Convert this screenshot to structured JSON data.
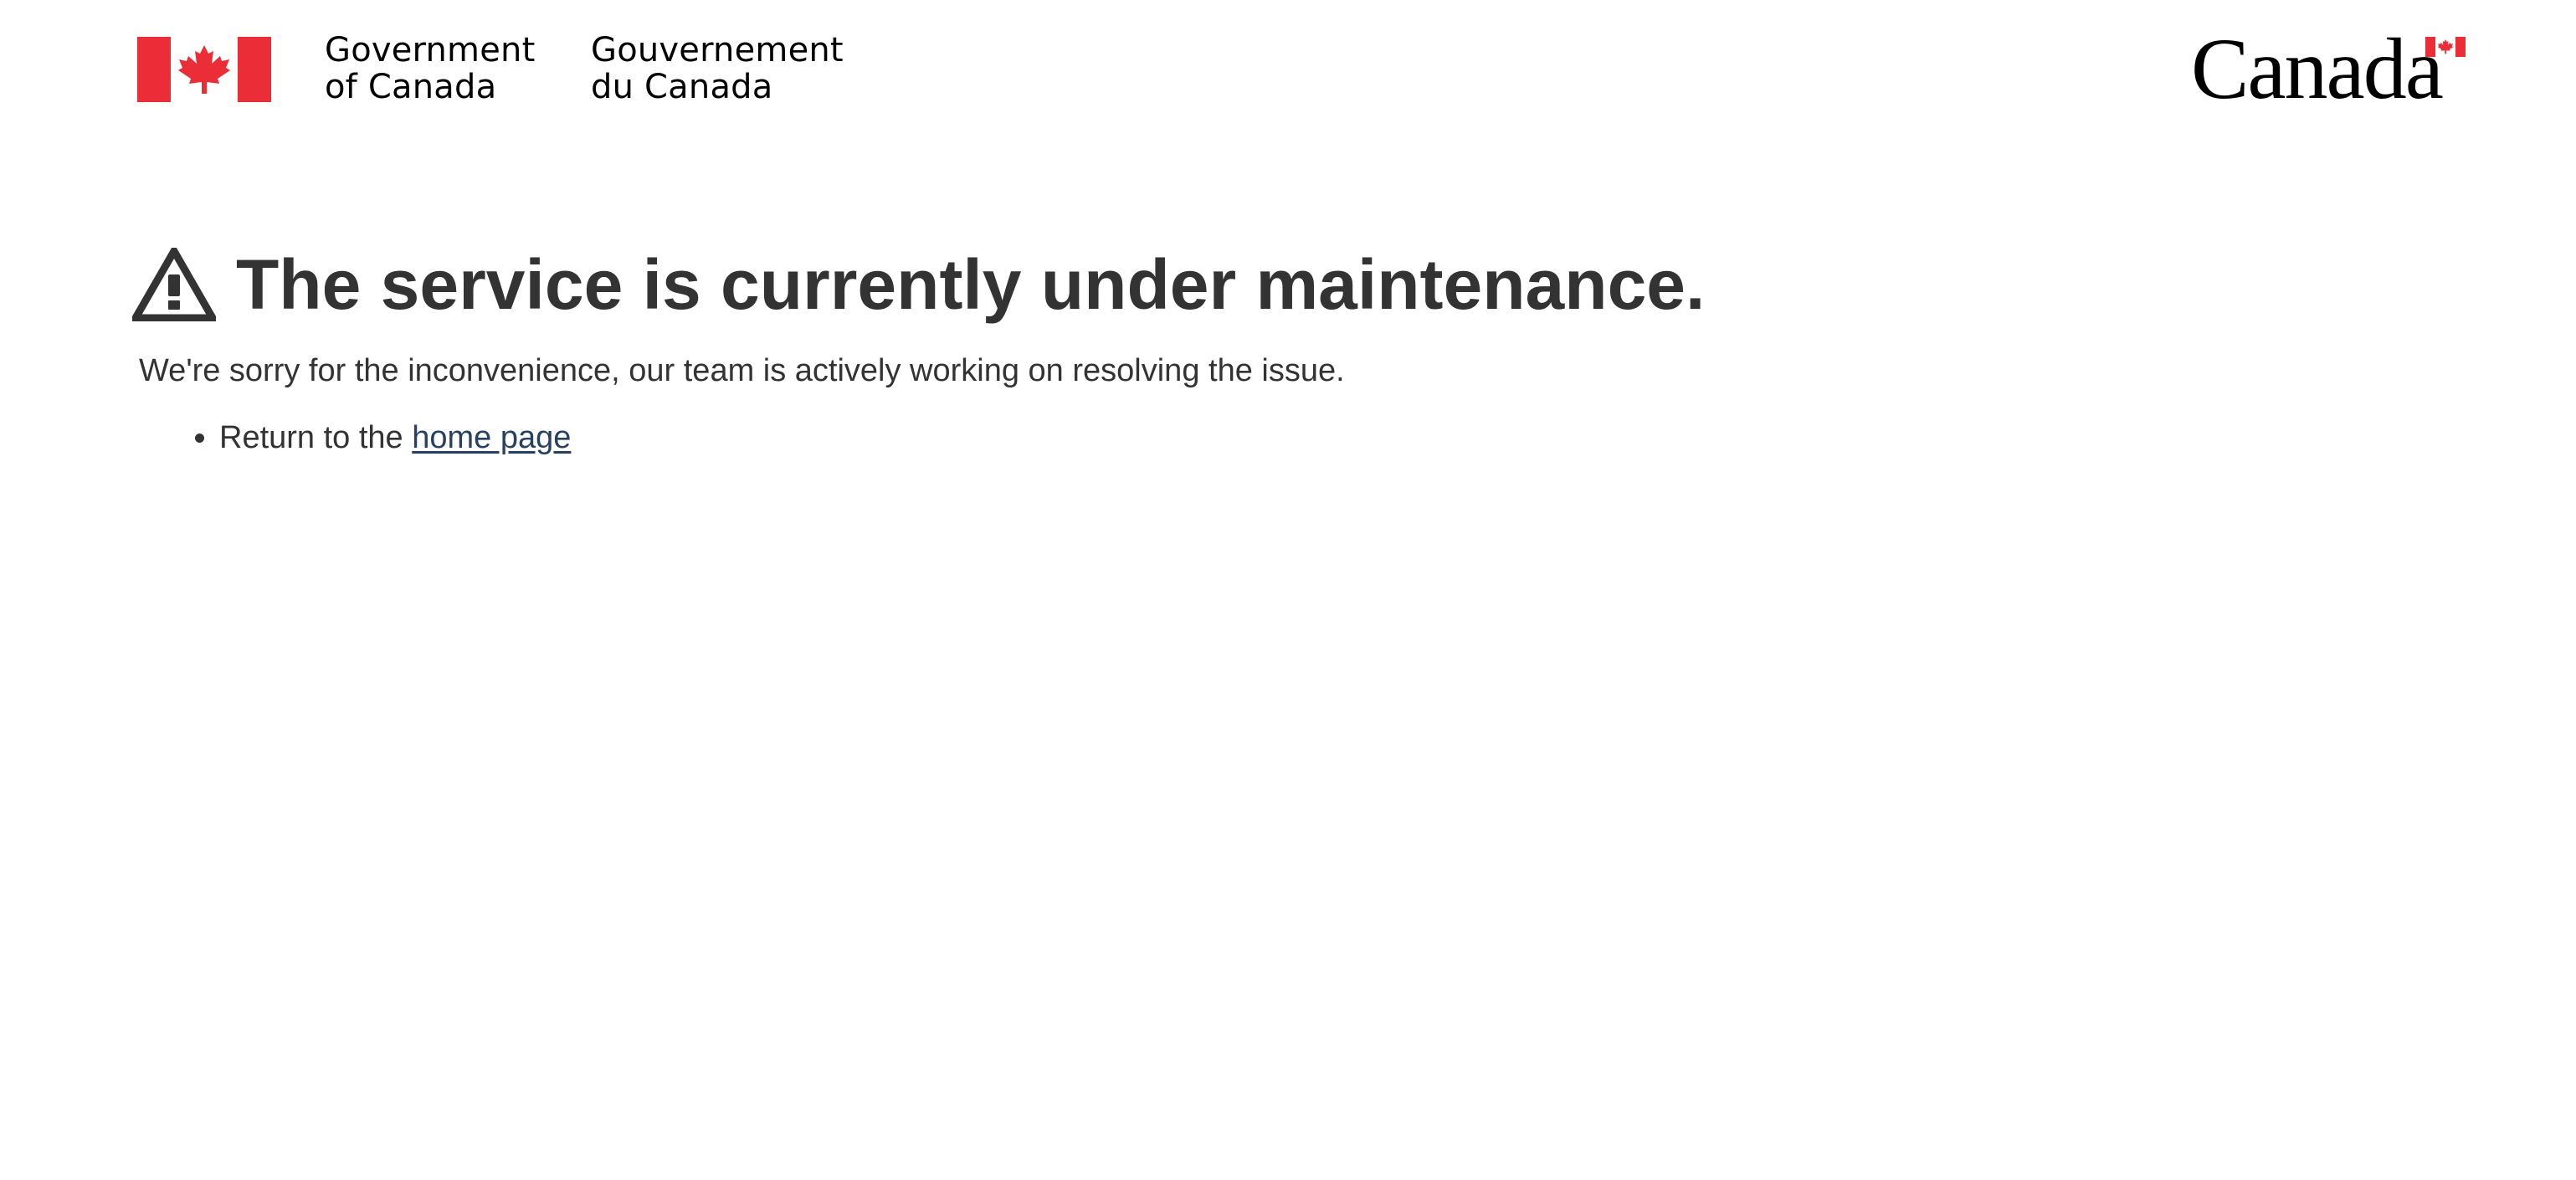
{
  "header": {
    "gov_en_line1": "Government",
    "gov_en_line2": "of Canada",
    "gov_fr_line1": "Gouvernement",
    "gov_fr_line2": "du Canada",
    "canada_wordmark": "Canada",
    "flag_icon": "canada-flag-icon",
    "colors": {
      "flag_red": "#EB2D37"
    }
  },
  "main": {
    "icon": "warning-triangle-icon",
    "title": "The service is currently under maintenance.",
    "description": "We're sorry for the inconvenience, our team is actively working on resolving the issue.",
    "return_prefix": "Return to the ",
    "home_link": "home page",
    "colors": {
      "text": "#333333",
      "link": "#284162"
    }
  }
}
